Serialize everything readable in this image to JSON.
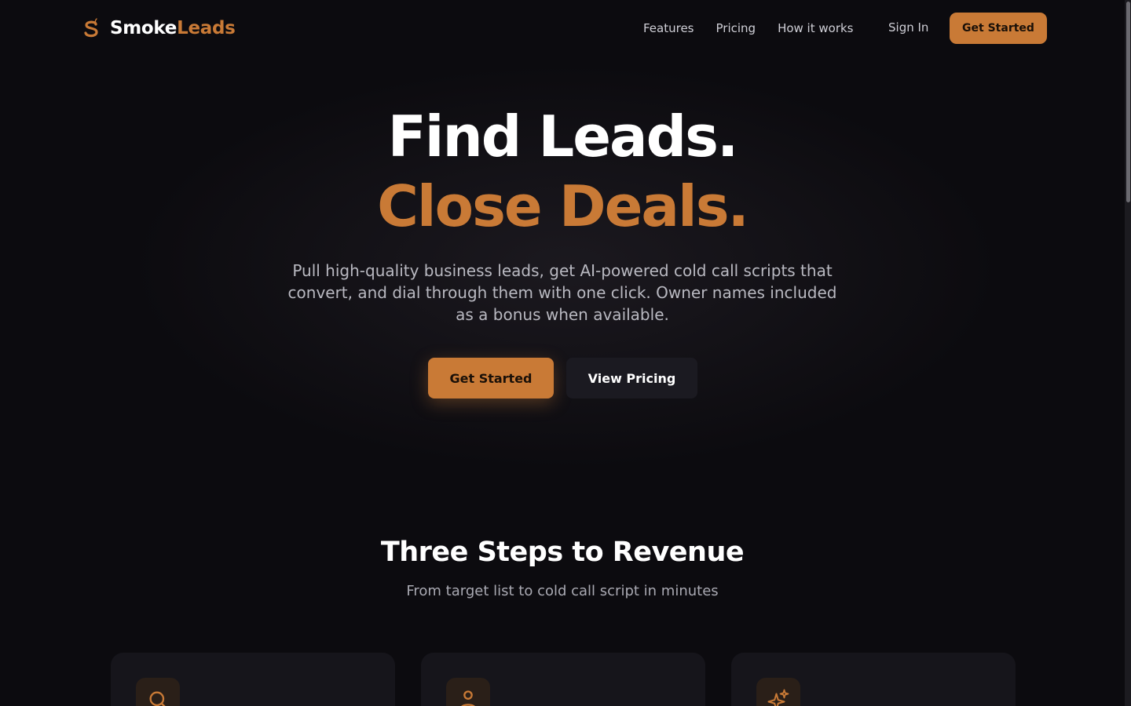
{
  "brand": {
    "name_part1": "Smoke",
    "name_part2": "Leads",
    "icon": "smoke-s-logo-icon"
  },
  "nav": {
    "links": [
      "Features",
      "Pricing",
      "How it works"
    ],
    "sign_in": "Sign In",
    "cta": "Get Started"
  },
  "hero": {
    "line1": "Find Leads.",
    "line2": "Close Deals.",
    "subtitle": "Pull high-quality business leads, get AI-powered cold call scripts that convert, and dial through them with one click. Owner names included as a bonus when available.",
    "primary_cta": "Get Started",
    "secondary_cta": "View Pricing"
  },
  "steps": {
    "title": "Three Steps to Revenue",
    "subtitle": "From target list to cold call script in minutes",
    "cards": [
      {
        "icon": "search-icon"
      },
      {
        "icon": "user-icon"
      },
      {
        "icon": "sparkles-icon"
      }
    ]
  },
  "colors": {
    "accent": "#c97a36",
    "background": "#0c0b0f",
    "card": "#16151b"
  }
}
